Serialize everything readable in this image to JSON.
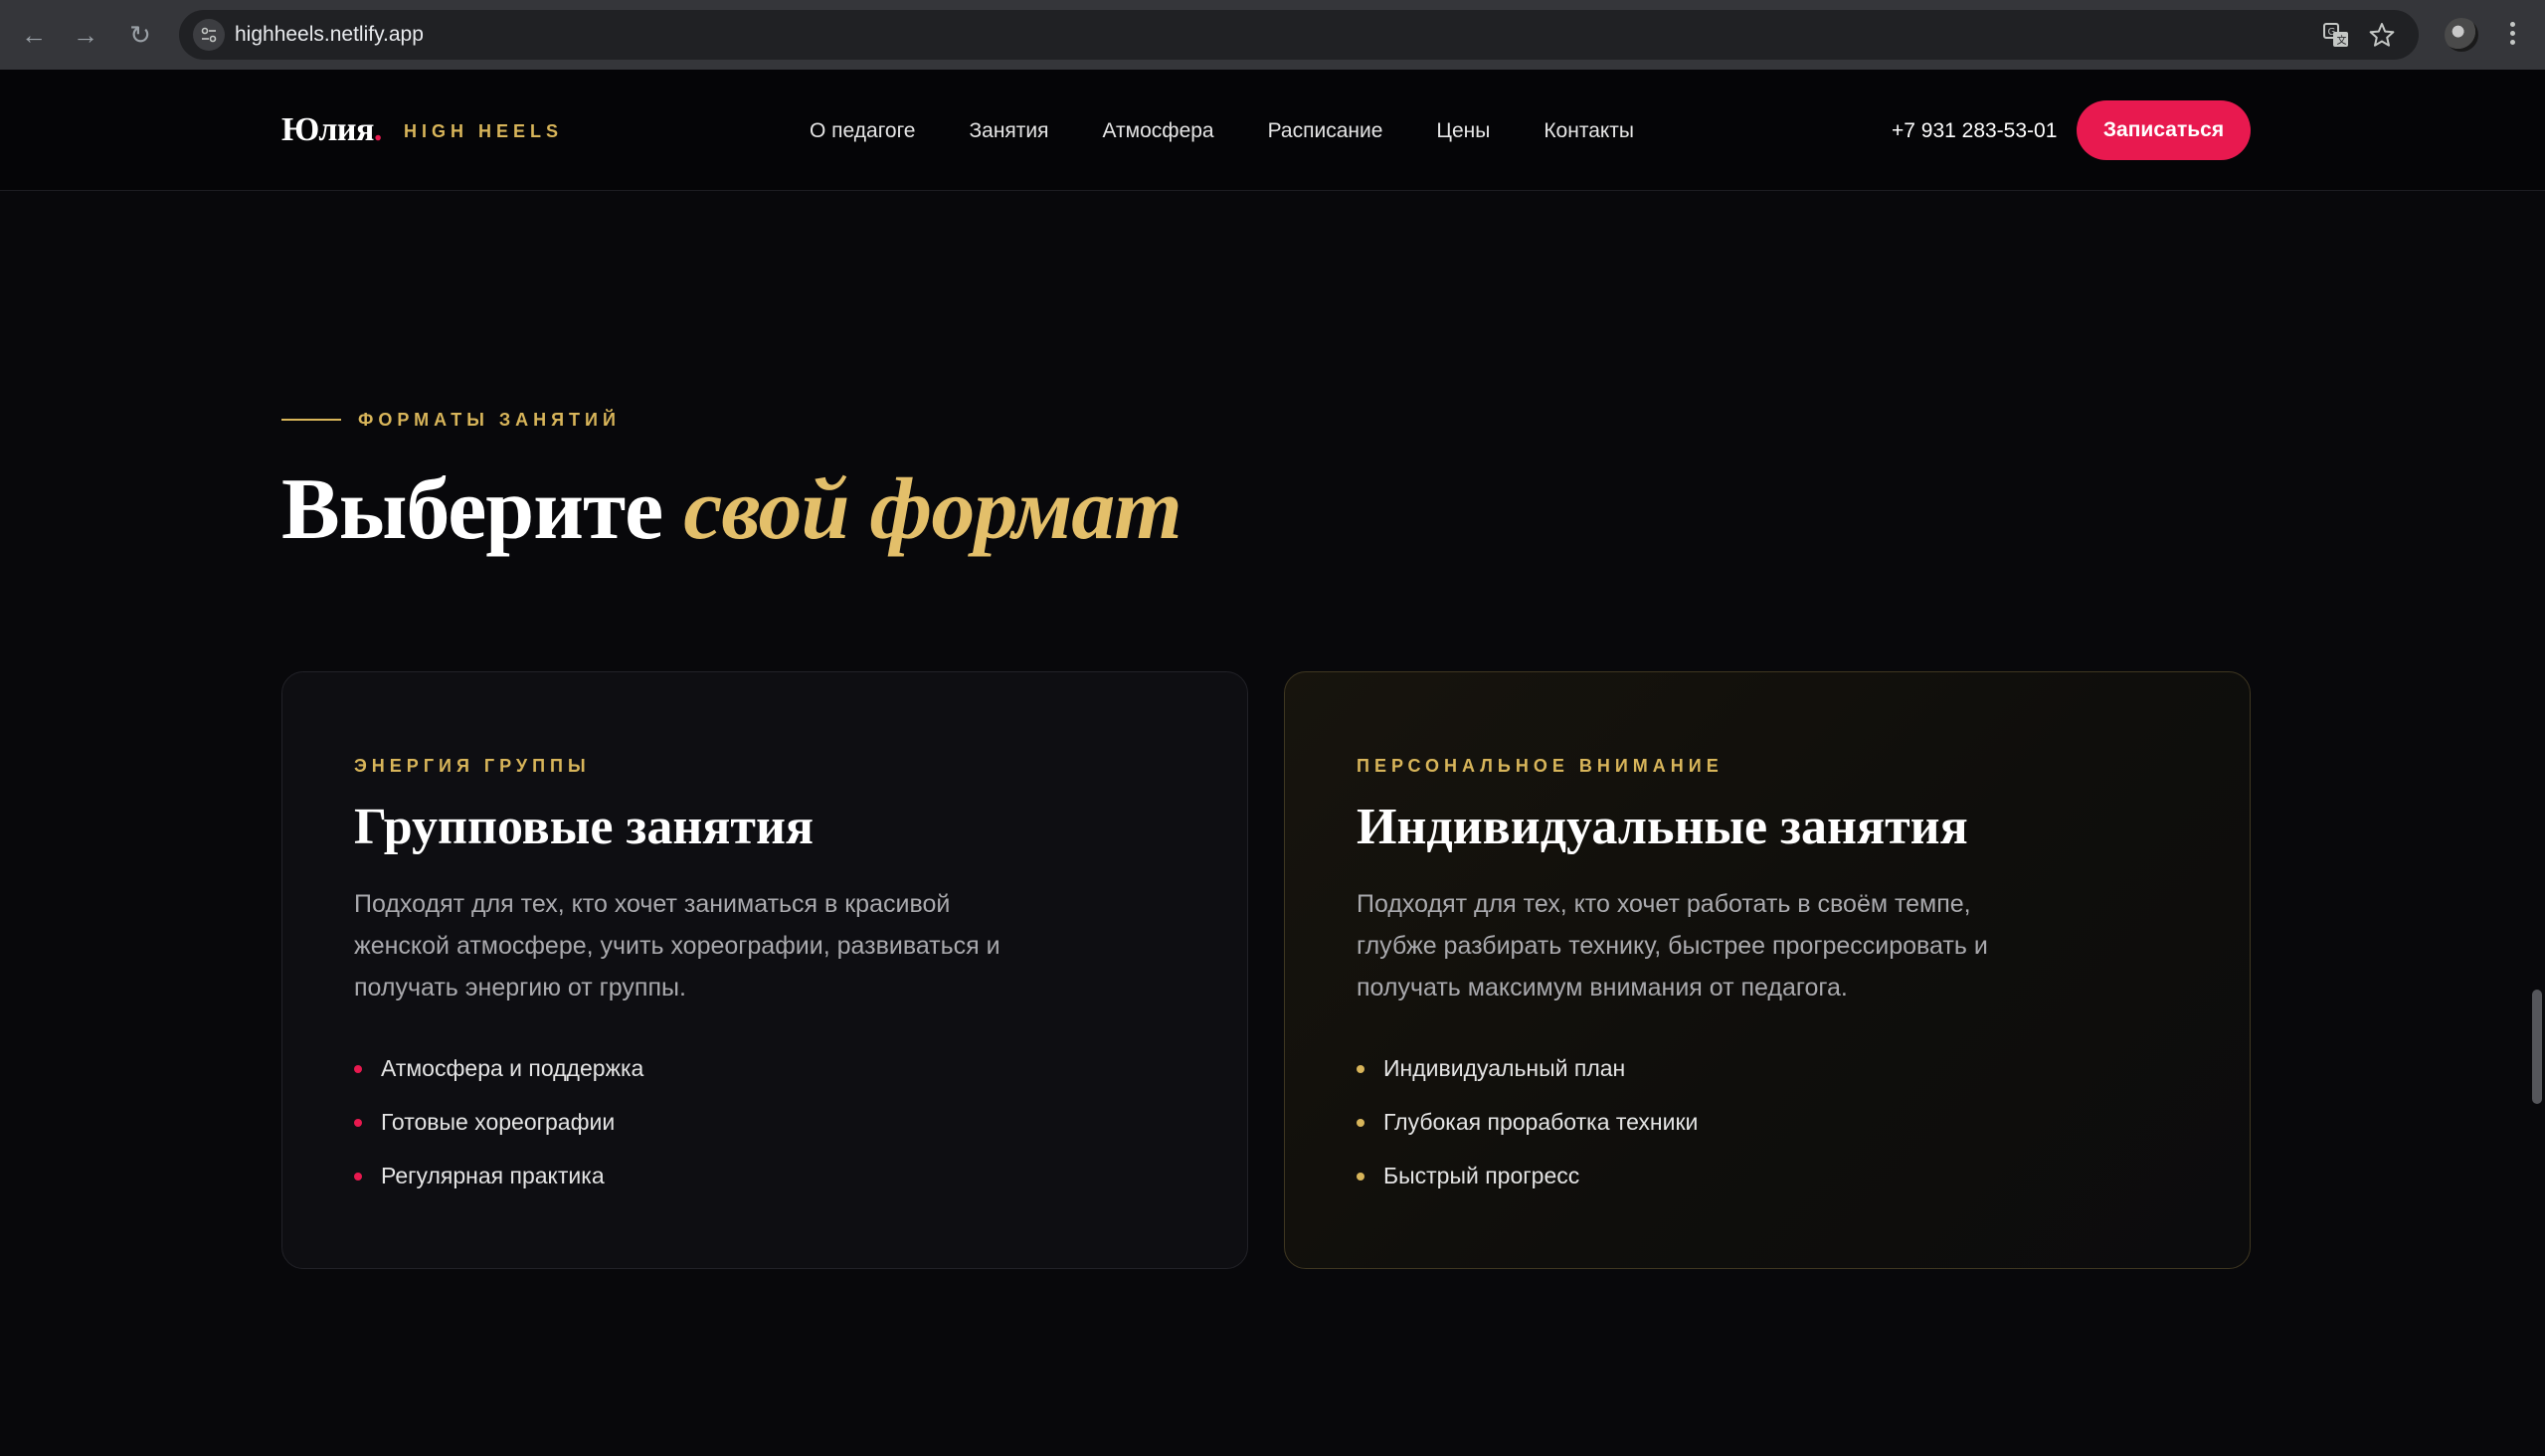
{
  "browser": {
    "url": "highheels.netlify.app",
    "icons": [
      "back-arrow-icon",
      "forward-arrow-icon",
      "reload-icon",
      "site-settings-icon",
      "translate-icon",
      "star-icon",
      "profile-avatar",
      "menu-dots-icon"
    ]
  },
  "header": {
    "logo": "Юлия",
    "logo_dot": ".",
    "logo_sub": "HIGH HEELS",
    "menu": [
      "О педагоге",
      "Занятия",
      "Атмосфера",
      "Расписание",
      "Цены",
      "Контакты"
    ],
    "phone": "+7 931 283-53-01",
    "cta": "Записаться"
  },
  "section": {
    "eyebrow": "ФОРМАТЫ ЗАНЯТИЙ",
    "title_plain": "Выберите ",
    "title_accent": "свой формат"
  },
  "cards": [
    {
      "eyebrow": "ЭНЕРГИЯ ГРУППЫ",
      "title": "Групповые занятия",
      "text": "Подходят для тех, кто хочет заниматься в красивой женской атмосфере, учить хореографии, развиваться и получать энергию от группы.",
      "items": [
        "Атмосфера и поддержка",
        "Готовые хореографии",
        "Регулярная практика"
      ]
    },
    {
      "eyebrow": "ПЕРСОНАЛЬНОЕ ВНИМАНИЕ",
      "title": "Индивидуальные занятия",
      "text": "Подходят для тех, кто хочет работать в своём темпе, глубже разбирать технику, быстрее прогрессировать и получать максимум внимания от педагога.",
      "items": [
        "Индивидуальный план",
        "Глубокая проработка техники",
        "Быстрый прогресс"
      ]
    }
  ],
  "colors": {
    "accent_pink": "#e8194f",
    "accent_gold": "#d8b55a",
    "background": "#08080b"
  }
}
